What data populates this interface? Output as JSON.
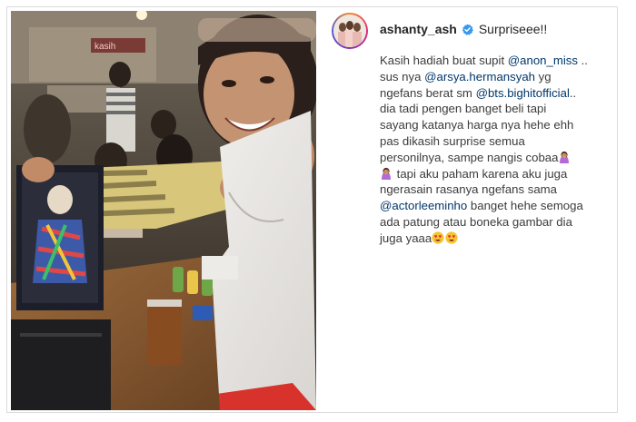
{
  "post": {
    "username": "ashanty_ash",
    "title_text": "Surpriseee!!",
    "verified": true,
    "caption": {
      "l1a": "Kasih hadiah buat supit ",
      "m1": "@anon_miss",
      "l1b": " ..",
      "l2a": "sus nya ",
      "m2": "@arsya.hermansyah",
      "l2b": " yg",
      "l3a": "ngefans berat sm ",
      "m3": "@bts.bighitofficial",
      "l3b": "..",
      "l4": "dia tadi pengen banget beli tapi",
      "l5": "sayang katanya harga nya hehe ehh",
      "l6": "pas dikasih surprise semua",
      "l7": "personilnya, sampe nangis cobaa",
      "l8": " tapi aku paham karena aku juga",
      "l9": "ngerasain rasanya ngefans sama",
      "m4": "@actorleeminho",
      "l10b": " banget hehe semoga",
      "l11": "ada patung atau boneka gambar dia",
      "l12": "juga yaaa"
    },
    "icons": {
      "face_palm_emoji": "woman-facepalming-emoji",
      "heart_eyes_emoji": "heart-eyes-emoji",
      "verified_badge": "verified-badge-icon"
    },
    "colors": {
      "mention": "#00376b",
      "verified": "#3897f0",
      "text": "#262626"
    },
    "photo_sign_text": "kasih"
  }
}
